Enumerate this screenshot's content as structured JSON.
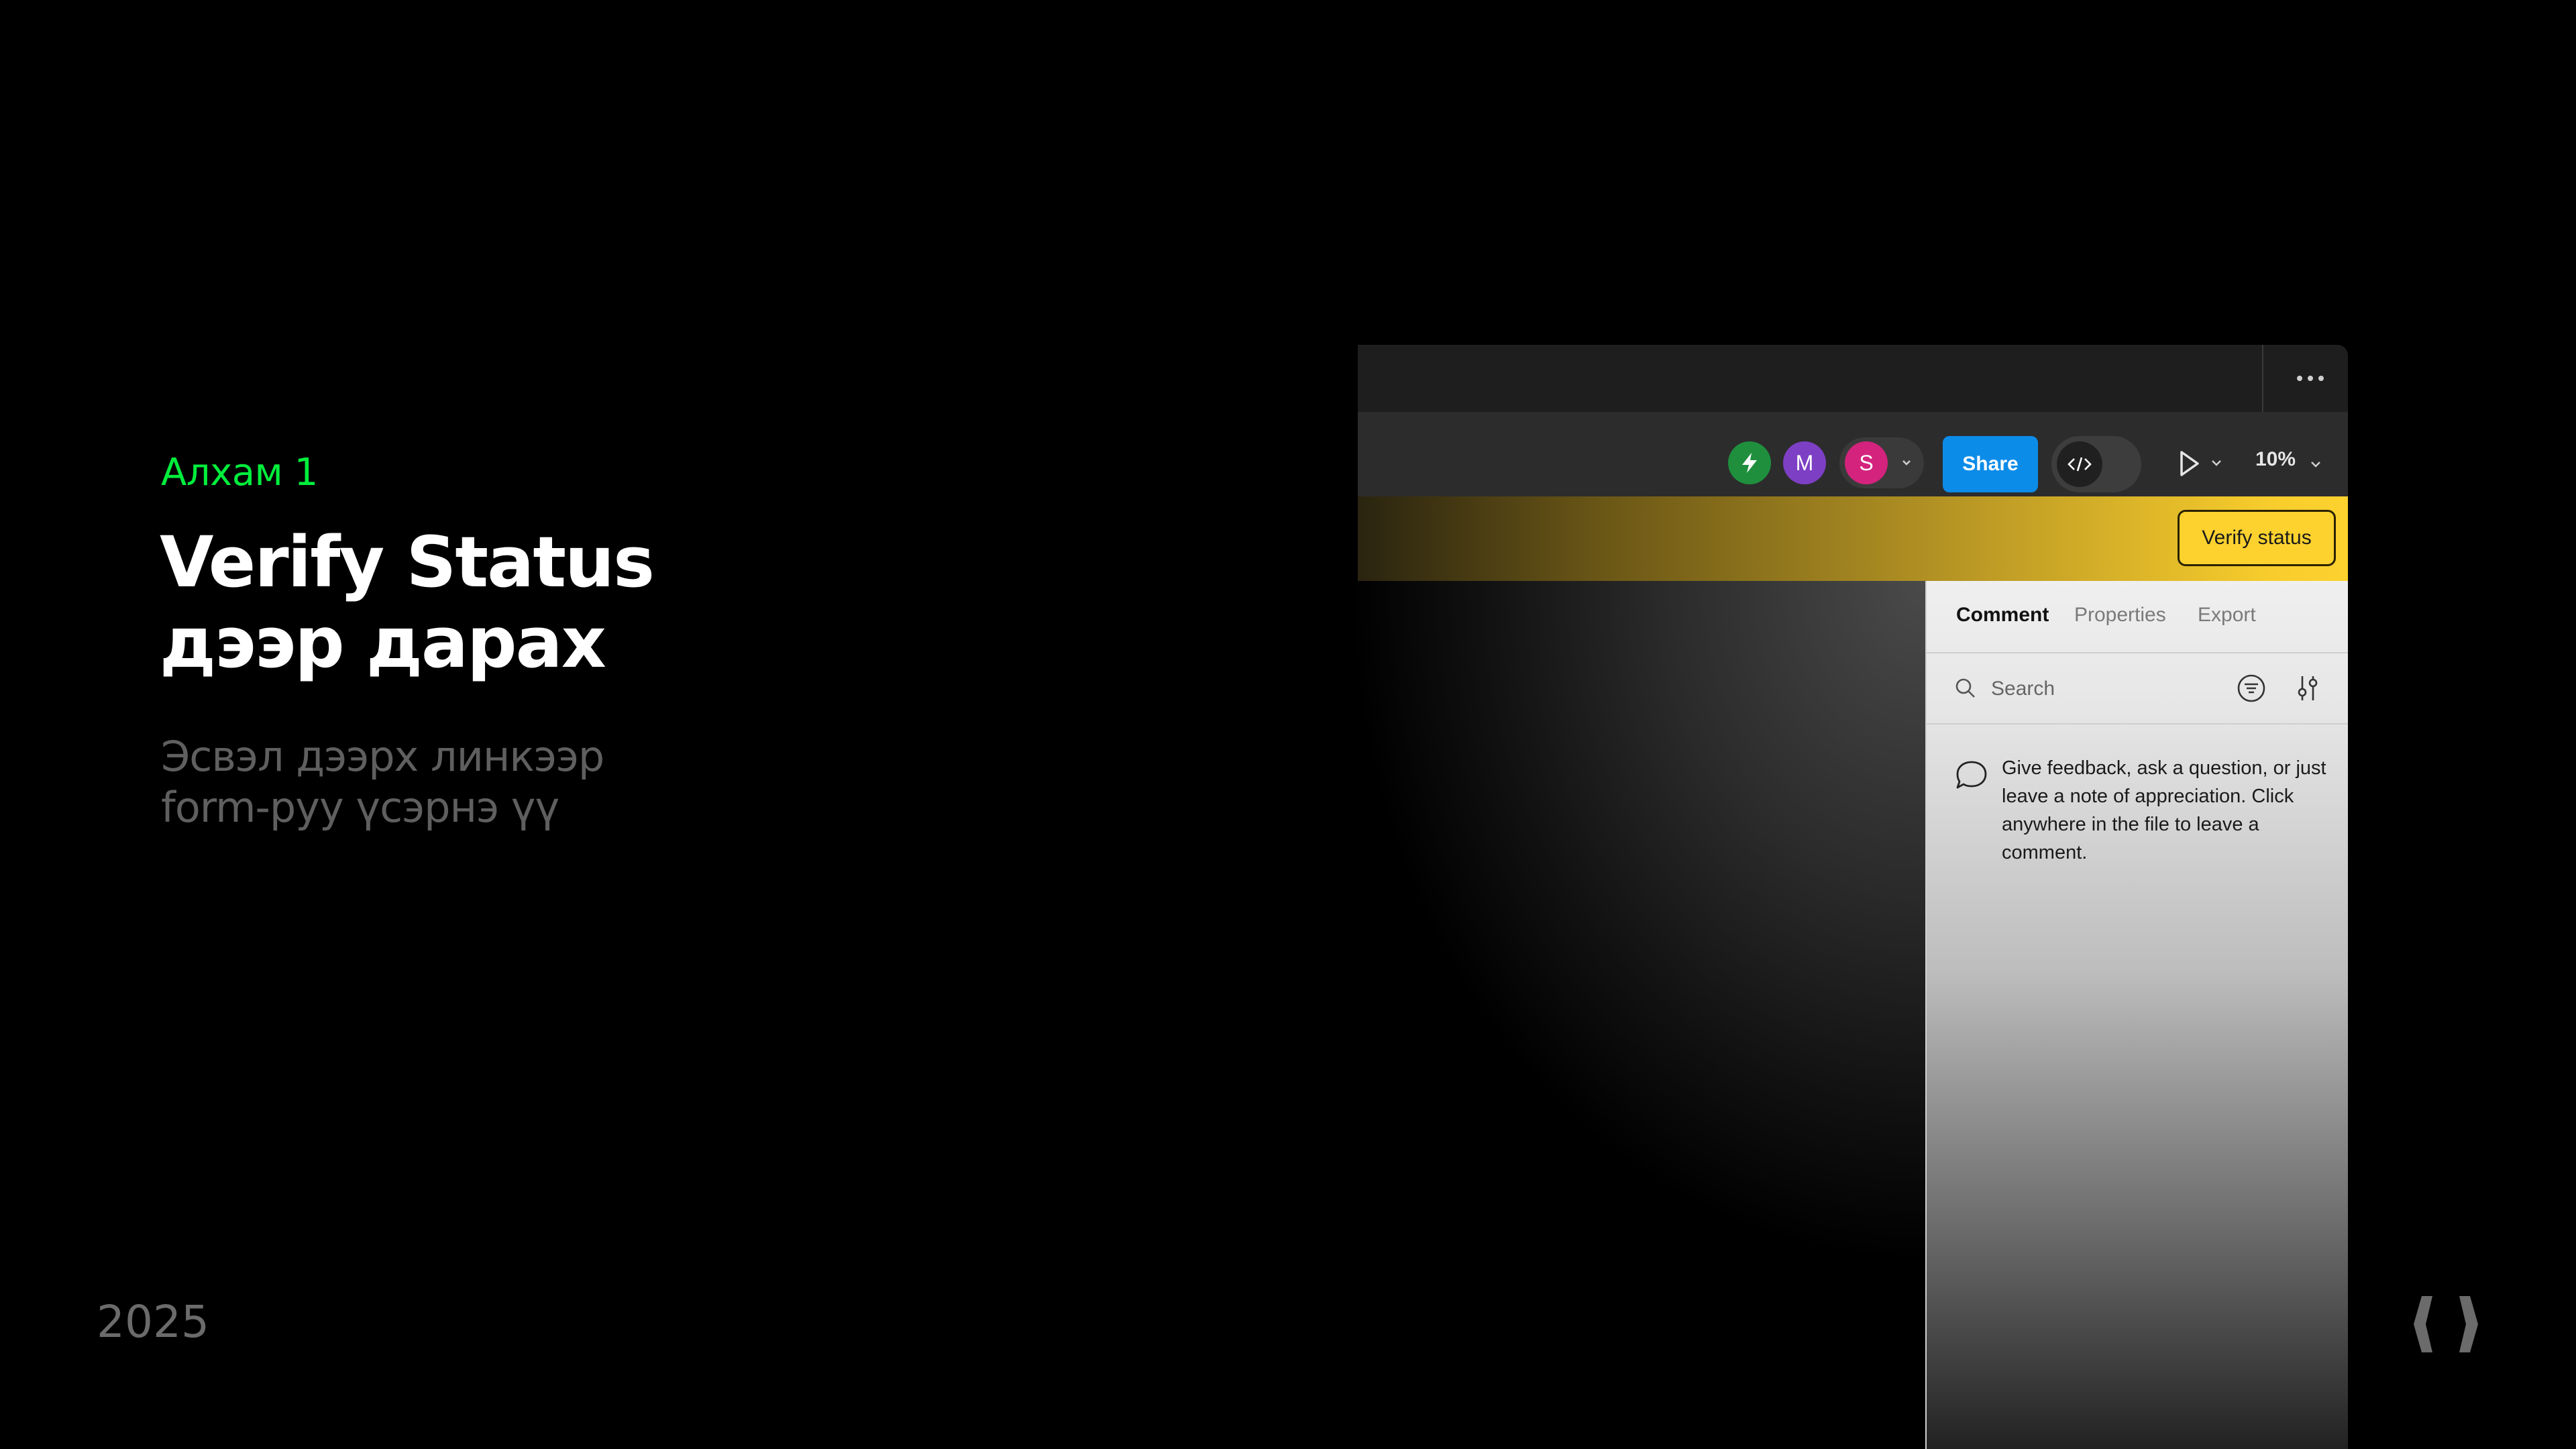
{
  "slide": {
    "step_label": "Алхам 1",
    "heading_line1": "Verify Status",
    "heading_line2": "дээр дарах",
    "sub_line1": "Эсвэл дээрх линкээр",
    "sub_line2": "form-руу үсэрнэ үү",
    "year": "2025",
    "accent_color": "#00ee3c"
  },
  "toolbar": {
    "avatars": [
      {
        "initial": "",
        "color": "#1f8f3d",
        "icon": "lightning-icon"
      },
      {
        "initial": "M",
        "color": "#7d3fc4"
      },
      {
        "initial": "S",
        "color": "#d4237d"
      }
    ],
    "share_label": "Share",
    "share_color": "#0c8ce9",
    "zoom": "10%"
  },
  "banner": {
    "verify_label": "Verify status",
    "color": "#fdd22f"
  },
  "panel": {
    "tabs": [
      {
        "label": "Comment",
        "active": true
      },
      {
        "label": "Properties",
        "active": false
      },
      {
        "label": "Export",
        "active": false
      }
    ],
    "search_placeholder": "Search",
    "empty_text": "Give feedback, ask a question, or just leave a note of appreciation. Click anywhere in the file to leave a comment."
  }
}
